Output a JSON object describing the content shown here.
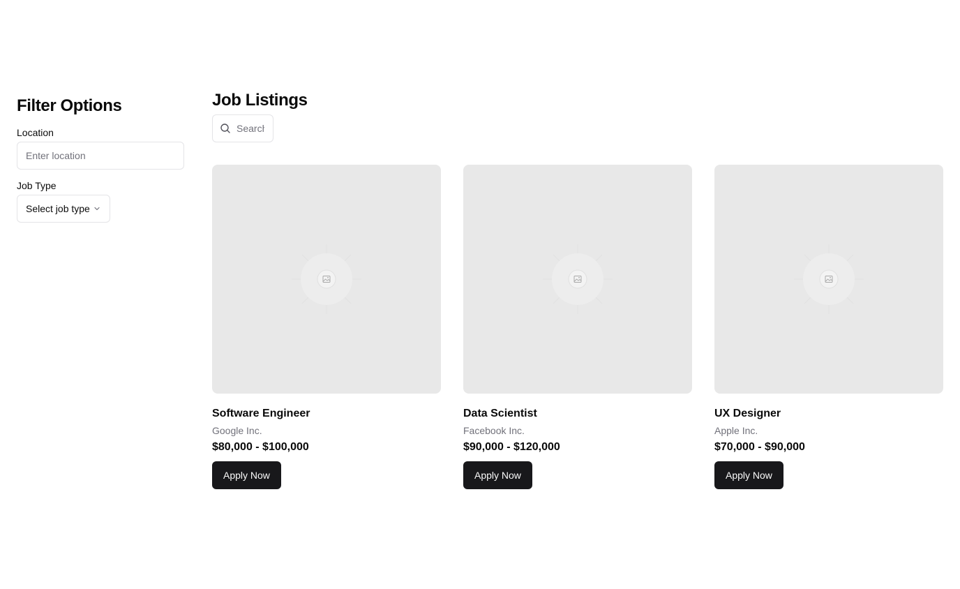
{
  "sidebar": {
    "title": "Filter Options",
    "location_label": "Location",
    "location_placeholder": "Enter location",
    "job_type_label": "Job Type",
    "job_type_value": "Select job type"
  },
  "main": {
    "title": "Job Listings",
    "search_placeholder": "Search"
  },
  "jobs": [
    {
      "title": "Software Engineer",
      "company": "Google Inc.",
      "salary": "$80,000 - $100,000",
      "button": "Apply Now"
    },
    {
      "title": "Data Scientist",
      "company": "Facebook Inc.",
      "salary": "$90,000 - $120,000",
      "button": "Apply Now"
    },
    {
      "title": "UX Designer",
      "company": "Apple Inc.",
      "salary": "$70,000 - $90,000",
      "button": "Apply Now"
    }
  ],
  "icons": {
    "search": "search-icon",
    "chevron": "chevron-down-icon",
    "image_placeholder": "image-placeholder-icon"
  },
  "colors": {
    "primary_button": "#18181b",
    "placeholder_bg": "#e8e8e8",
    "muted_text": "#71717a",
    "border": "#e4e4e7"
  }
}
